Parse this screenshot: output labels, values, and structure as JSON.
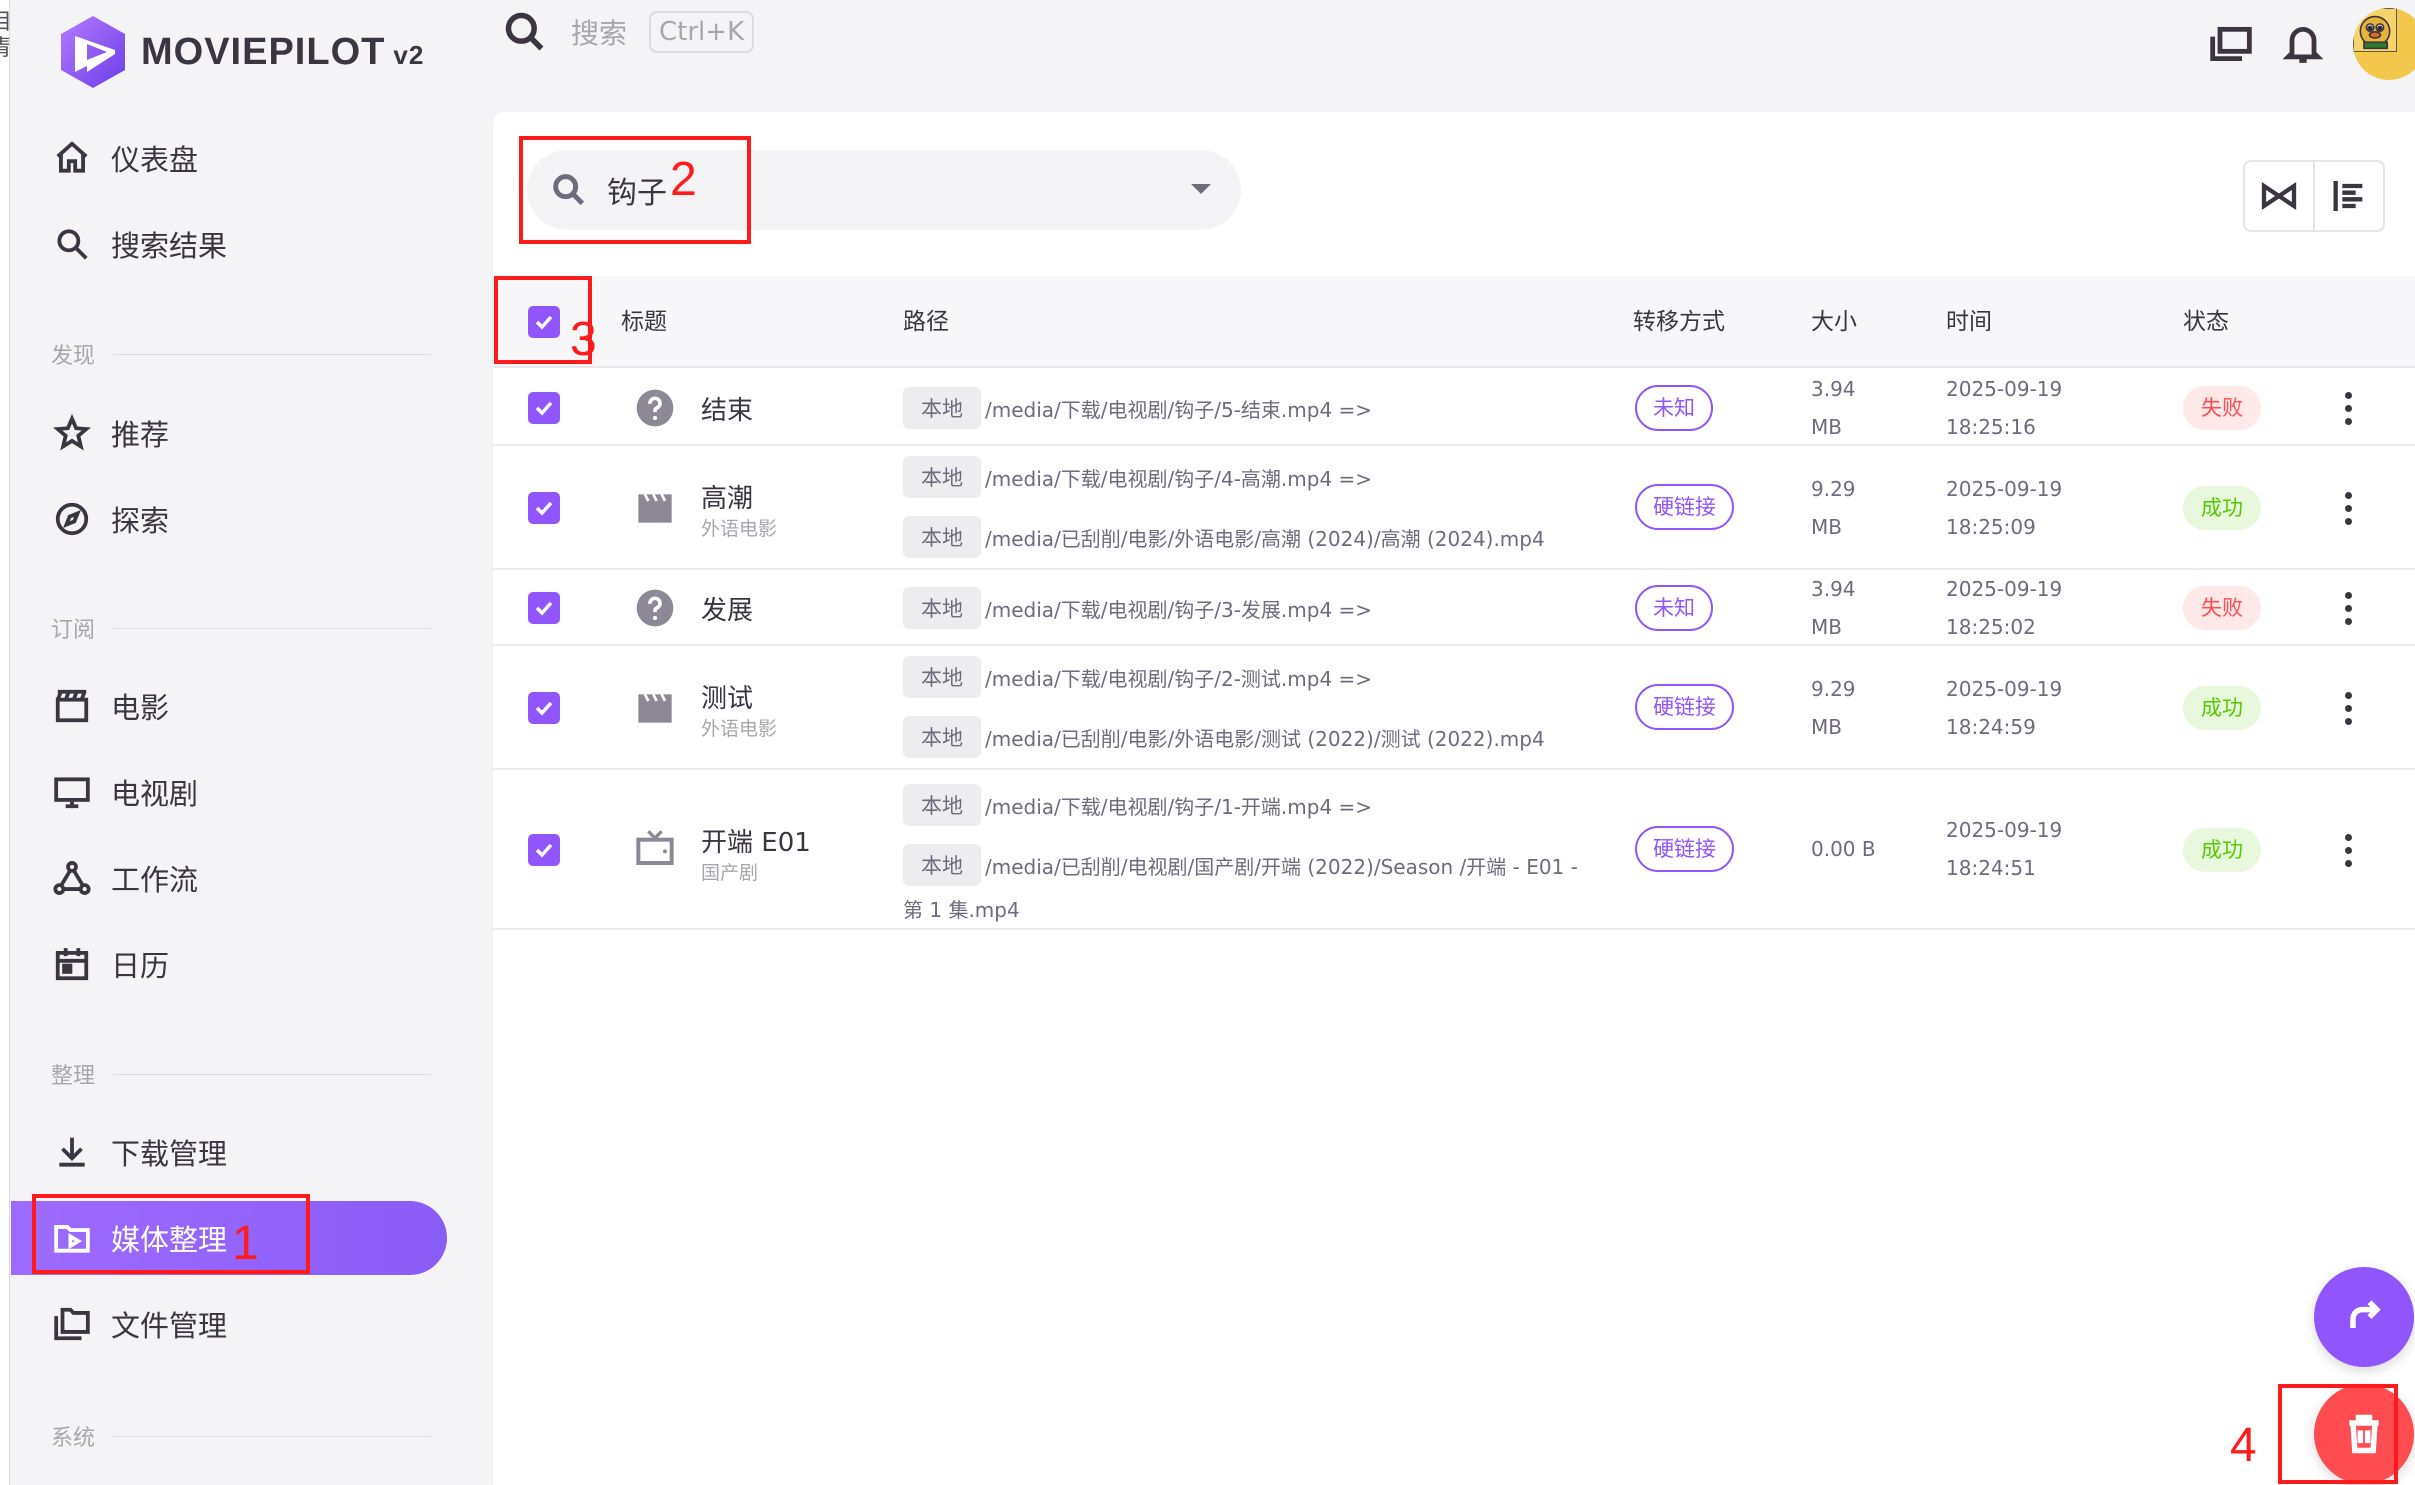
{
  "edge_chars": [
    "目",
    "青",
    "i"
  ],
  "app": {
    "name": "MOVIEPILOT",
    "version": "v2"
  },
  "sidebar": {
    "items_top": [
      {
        "label": "仪表盘",
        "icon": "home-icon"
      },
      {
        "label": "搜索结果",
        "icon": "search-icon"
      }
    ],
    "section_discover": "发现",
    "items_discover": [
      {
        "label": "推荐",
        "icon": "star-icon"
      },
      {
        "label": "探索",
        "icon": "compass-icon"
      }
    ],
    "section_subscribe": "订阅",
    "items_subscribe": [
      {
        "label": "电影",
        "icon": "movie-clapper-icon"
      },
      {
        "label": "电视剧",
        "icon": "monitor-icon"
      },
      {
        "label": "工作流",
        "icon": "workflow-icon"
      },
      {
        "label": "日历",
        "icon": "calendar-icon"
      }
    ],
    "section_organize": "整理",
    "items_organize": [
      {
        "label": "下载管理",
        "icon": "download-icon"
      },
      {
        "label": "媒体整理",
        "icon": "folder-play-icon",
        "active": true
      },
      {
        "label": "文件管理",
        "icon": "folders-icon"
      }
    ],
    "section_system": "系统"
  },
  "topbar": {
    "search_placeholder": "搜索",
    "shortcut": "Ctrl+K"
  },
  "filter": {
    "value": "钩子"
  },
  "table": {
    "headers": {
      "title": "标题",
      "path": "路径",
      "transfer": "转移方式",
      "size": "大小",
      "time": "时间",
      "status": "状态"
    },
    "rows": [
      {
        "title": "结束",
        "subtitle": "",
        "icon": "question-icon",
        "src_tag": "本地",
        "src": "/media/下载/电视剧/钩子/5-结束.mp4 =>",
        "dst_tag": "",
        "dst": "",
        "dst_cont": "",
        "transfer": "未知",
        "size1": "3.94",
        "size2": "MB",
        "date": "2025-09-19",
        "clock": "18:25:16",
        "status": "失败",
        "status_kind": "fail"
      },
      {
        "title": "高潮",
        "subtitle": "外语电影",
        "icon": "clapperboard-icon",
        "src_tag": "本地",
        "src": "/media/下载/电视剧/钩子/4-高潮.mp4 =>",
        "dst_tag": "本地",
        "dst": "/media/已刮削/电影/外语电影/高潮 (2024)/高潮 (2024).mp4",
        "dst_cont": "",
        "transfer": "硬链接",
        "size1": "9.29",
        "size2": "MB",
        "date": "2025-09-19",
        "clock": "18:25:09",
        "status": "成功",
        "status_kind": "ok"
      },
      {
        "title": "发展",
        "subtitle": "",
        "icon": "question-icon",
        "src_tag": "本地",
        "src": "/media/下载/电视剧/钩子/3-发展.mp4 =>",
        "dst_tag": "",
        "dst": "",
        "dst_cont": "",
        "transfer": "未知",
        "size1": "3.94",
        "size2": "MB",
        "date": "2025-09-19",
        "clock": "18:25:02",
        "status": "失败",
        "status_kind": "fail"
      },
      {
        "title": "测试",
        "subtitle": "外语电影",
        "icon": "clapperboard-icon",
        "src_tag": "本地",
        "src": "/media/下载/电视剧/钩子/2-测试.mp4 =>",
        "dst_tag": "本地",
        "dst": "/media/已刮削/电影/外语电影/测试 (2022)/测试 (2022).mp4",
        "dst_cont": "",
        "transfer": "硬链接",
        "size1": "9.29",
        "size2": "MB",
        "date": "2025-09-19",
        "clock": "18:24:59",
        "status": "成功",
        "status_kind": "ok"
      },
      {
        "title": "开端 E01",
        "subtitle": "国产剧",
        "icon": "tv-icon",
        "src_tag": "本地",
        "src": "/media/下载/电视剧/钩子/1-开端.mp4 =>",
        "dst_tag": "本地",
        "dst": "/media/已刮削/电视剧/国产剧/开端 (2022)/Season /开端 - E01 -",
        "dst_cont": "第 1 集.mp4",
        "transfer": "硬链接",
        "size1": "0.00 B",
        "size2": "",
        "date": "2025-09-19",
        "clock": "18:24:51",
        "status": "成功",
        "status_kind": "ok"
      }
    ]
  },
  "annotations": [
    "1",
    "2",
    "3",
    "4"
  ],
  "colors": {
    "primary": "#9155fd",
    "danger": "#ff4c51",
    "success": "#56ca00",
    "annotation": "#ff1b1b"
  }
}
